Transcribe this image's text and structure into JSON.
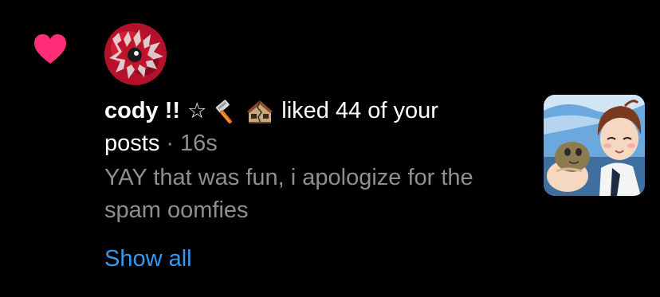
{
  "notification": {
    "username": "cody !!",
    "star": "☆",
    "emoji_1_icon": "razor-icon",
    "emoji_2_icon": "broken-house-icon",
    "action_text": "liked 44 of your",
    "object_text": "posts",
    "separator": "·",
    "timestamp": "16s",
    "comment": "YAY that was fun, i apologize for the spam oomfies",
    "show_all_label": "Show all"
  },
  "icons": {
    "like": "heart-icon",
    "avatar": "profile-avatar",
    "thumbnail": "post-thumbnail"
  },
  "colors": {
    "background": "#000000",
    "heart": "#ff2d78",
    "primary_text": "#ffffff",
    "secondary_text": "#8e8e93",
    "link": "#3897f0"
  }
}
